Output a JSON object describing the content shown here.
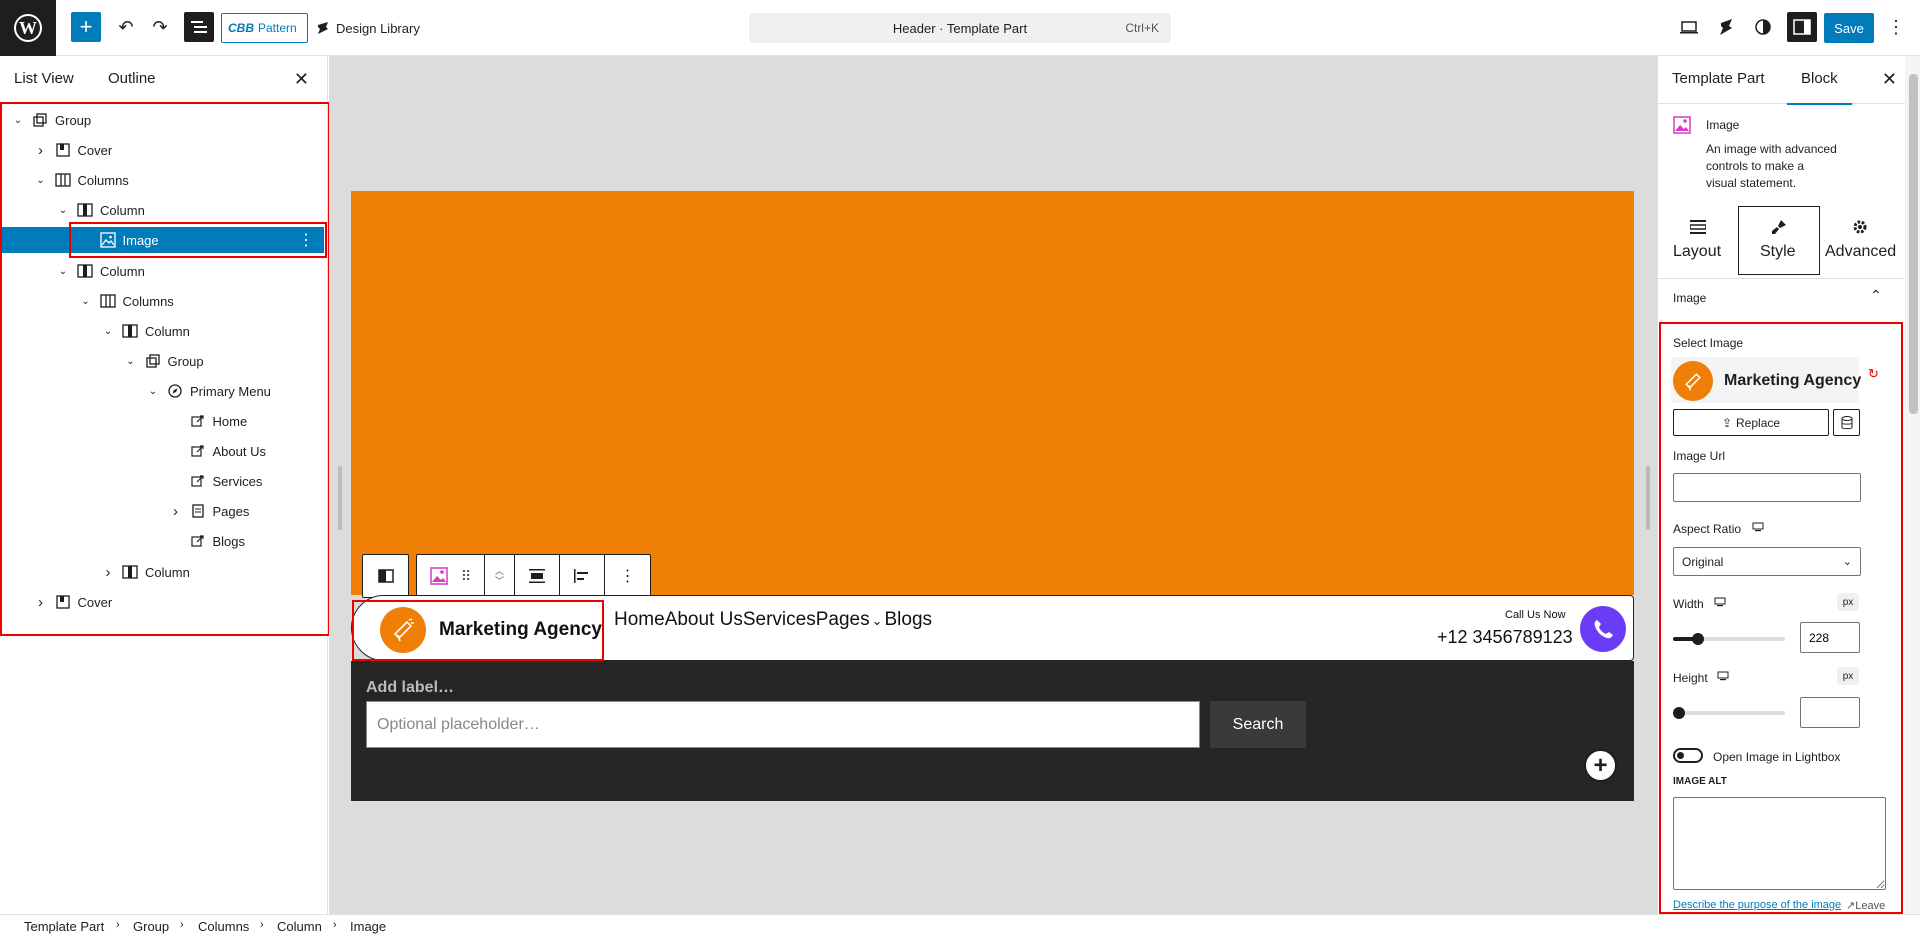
{
  "topbar": {
    "pattern_label": "Pattern",
    "pattern_prefix": "CBB",
    "design_library": "Design Library",
    "command_title": "Header · Template Part",
    "command_shortcut": "Ctrl+K",
    "save": "Save"
  },
  "left_panel": {
    "tabs": [
      "List View",
      "Outline"
    ],
    "tree": [
      {
        "label": "Group",
        "indent": 0,
        "chevron": "down",
        "icon": "group"
      },
      {
        "label": "Cover",
        "indent": 1,
        "chevron": "right",
        "icon": "cover"
      },
      {
        "label": "Columns",
        "indent": 1,
        "chevron": "down",
        "icon": "columns"
      },
      {
        "label": "Column",
        "indent": 2,
        "chevron": "down",
        "icon": "column"
      },
      {
        "label": "Image",
        "indent": 3,
        "chevron": "",
        "icon": "image",
        "selected": true
      },
      {
        "label": "Column",
        "indent": 2,
        "chevron": "down",
        "icon": "column"
      },
      {
        "label": "Columns",
        "indent": 3,
        "chevron": "down",
        "icon": "columns"
      },
      {
        "label": "Column",
        "indent": 4,
        "chevron": "down",
        "icon": "column"
      },
      {
        "label": "Group",
        "indent": 5,
        "chevron": "down",
        "icon": "group"
      },
      {
        "label": "Primary Menu",
        "indent": 6,
        "chevron": "down",
        "icon": "navigation"
      },
      {
        "label": "Home",
        "indent": 7,
        "chevron": "",
        "icon": "link"
      },
      {
        "label": "About Us",
        "indent": 7,
        "chevron": "",
        "icon": "link"
      },
      {
        "label": "Services",
        "indent": 7,
        "chevron": "",
        "icon": "link"
      },
      {
        "label": "Pages",
        "indent": 7,
        "chevron": "right",
        "icon": "page"
      },
      {
        "label": "Blogs",
        "indent": 7,
        "chevron": "",
        "icon": "link"
      },
      {
        "label": "Column",
        "indent": 4,
        "chevron": "right",
        "icon": "column"
      },
      {
        "label": "Cover",
        "indent": 1,
        "chevron": "right",
        "icon": "cover"
      }
    ]
  },
  "canvas": {
    "brand": "Marketing Agency",
    "nav": [
      "Home",
      "About Us",
      "Services",
      "Pages",
      "Blogs"
    ],
    "nav_dropdown_glyph": "⌄",
    "call_label": "Call Us Now",
    "phone": "+12 3456789123",
    "search_label": "Add label…",
    "search_placeholder": "Optional placeholder…",
    "search_button": "Search",
    "colors": {
      "orange": "#ef7f06",
      "purple": "#6a3cf5",
      "dark": "#262626"
    }
  },
  "right_panel": {
    "tabs": [
      "Template Part",
      "Block"
    ],
    "block_name": "Image",
    "block_desc": [
      "An image with advanced",
      "controls to make a",
      "visual statement."
    ],
    "style_tabs": [
      "Layout",
      "Style",
      "Advanced"
    ],
    "section": "Image",
    "select_image": "Select Image",
    "preview_text": "Marketing Agency",
    "replace": "Replace",
    "image_url_label": "Image Url",
    "image_url_value": "",
    "aspect_label": "Aspect Ratio",
    "aspect_value": "Original",
    "width_label": "Width",
    "width_value": "228",
    "width_slider": 0.22,
    "height_label": "Height",
    "height_value": "",
    "height_slider": 0,
    "unit": "px",
    "lightbox_label": "Open Image in Lightbox",
    "alt_label": "IMAGE ALT",
    "alt_link": "Describe the purpose of the image",
    "alt_link_suffix": "Leave"
  },
  "breadcrumb": [
    "Template Part",
    "Group",
    "Columns",
    "Column",
    "Image"
  ]
}
